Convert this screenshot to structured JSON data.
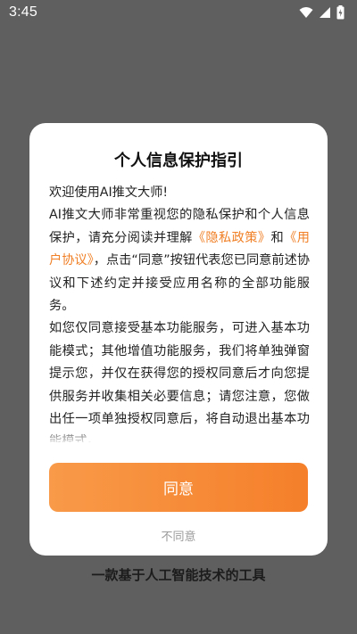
{
  "status_bar": {
    "time": "3:45",
    "icons": [
      "wifi-icon",
      "signal-icon",
      "battery-charging-icon"
    ],
    "text_color": "#ffffff"
  },
  "dialog": {
    "title": "个人信息保护指引",
    "greeting": "欢迎使用AI推文大师!",
    "para1_pre": "AI推文大师非常重视您的隐私保护和个人信息保护，请充分阅读并理解",
    "privacy_link": "《隐私政策》",
    "and": "和",
    "user_agreement_link": "《用户协议》",
    "para1_post": "，点击“同意”按钮代表您已同意前述协议和下述约定并接受应用名称的全部功能服务。",
    "para2": "如您仅同意接受基本功能服务，可进入基本功能模式；其他增值功能服务，我们将单独弹窗提示您，并仅在获得您的授权同意后才向您提供服务并收集相关必要信息；请您注意，您做出任一项单独授权同意后，将自动退出基本功能模式。",
    "agree_label": "同意",
    "disagree_label": "不同意"
  },
  "tagline": "一款基于人工智能技术的工具",
  "colors": {
    "background_overlay": "#5f5f5f",
    "dialog_bg": "#ffffff",
    "accent_orange": "#f57f2a",
    "link_orange": "#f07f25",
    "muted_gray": "#9a9a9a"
  }
}
